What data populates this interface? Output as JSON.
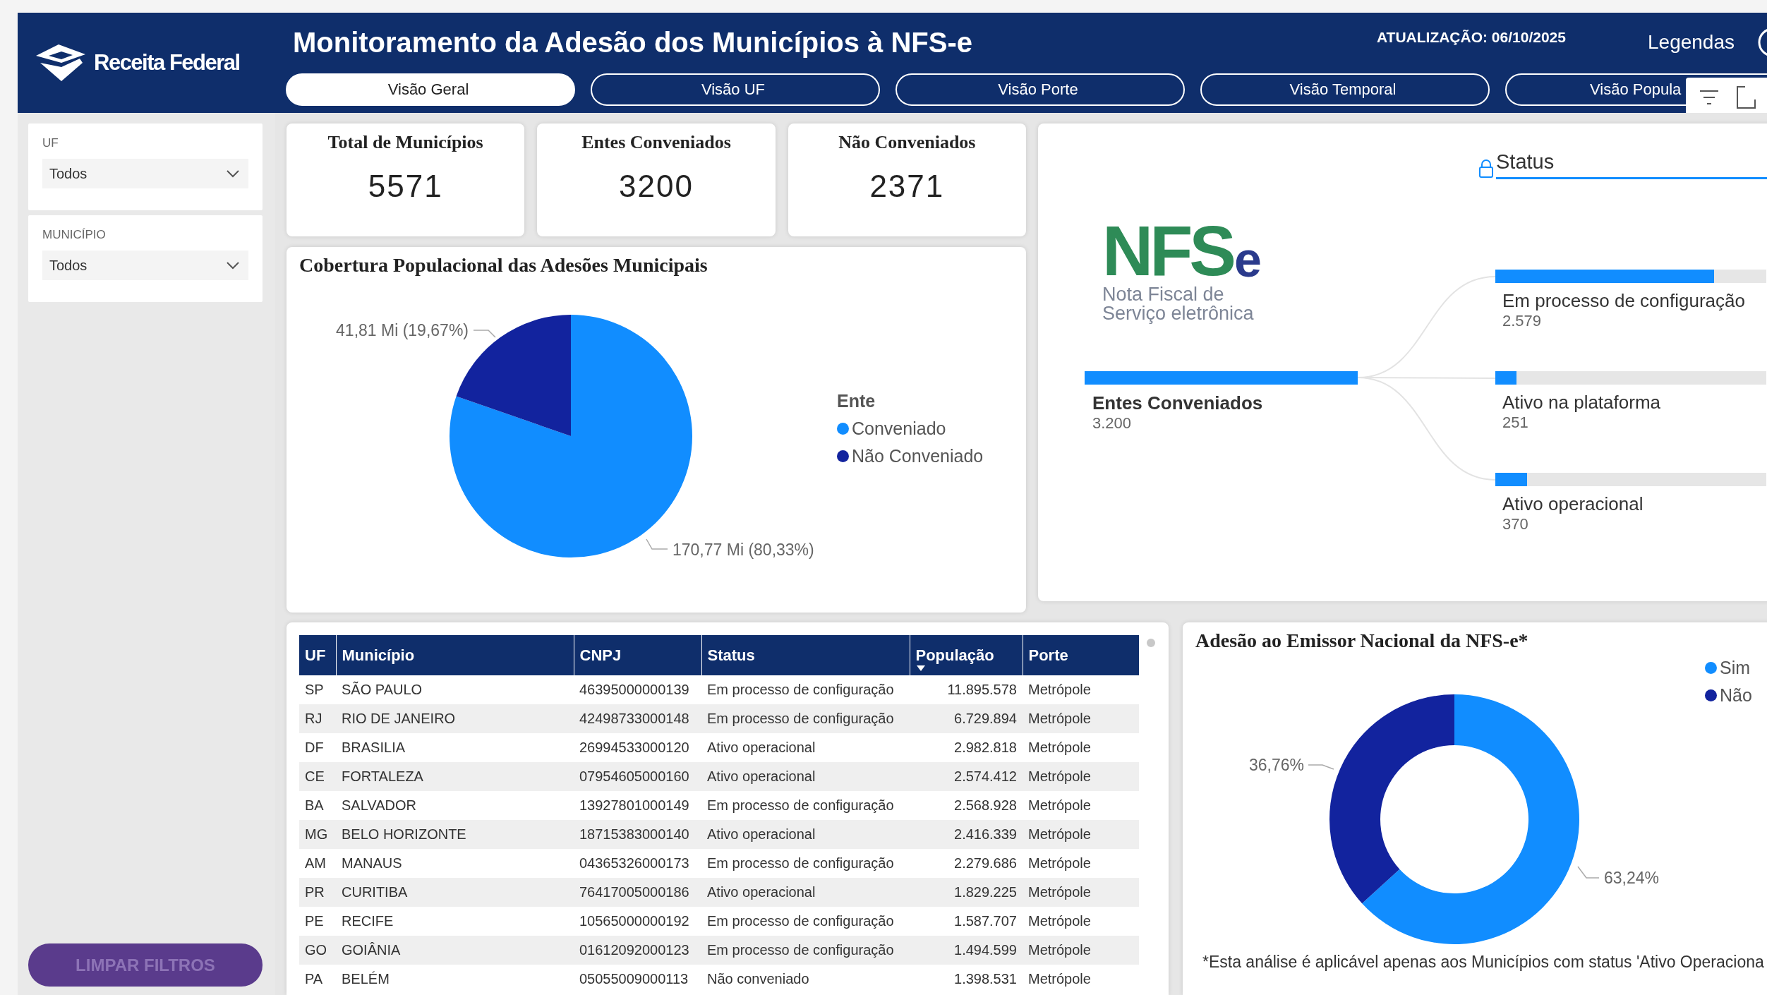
{
  "header": {
    "logo_text": "Receita Federal",
    "title": "Monitoramento da Adesão dos Municípios à NFS-e",
    "update": "ATUALIZAÇÃO: 06/10/2025",
    "legend_link": "Legendas",
    "tabs": [
      {
        "label": "Visão Geral",
        "selected": true
      },
      {
        "label": "Visão UF",
        "selected": false
      },
      {
        "label": "Visão Porte",
        "selected": false
      },
      {
        "label": "Visão Temporal",
        "selected": false
      },
      {
        "label": "Visão Popula",
        "selected": false
      }
    ]
  },
  "sidebar": {
    "slicers": [
      {
        "label": "UF",
        "value": "Todos"
      },
      {
        "label": "MUNICÍPIO",
        "value": "Todos"
      }
    ],
    "clear_button": "LIMPAR FILTROS"
  },
  "kpis": [
    {
      "label": "Total de Municípios",
      "value": "5571"
    },
    {
      "label": "Entes Conveniados",
      "value": "3200"
    },
    {
      "label": "Não Conveniados",
      "value": "2371"
    }
  ],
  "coverage": {
    "title": "Cobertura Populacional das Adesões Municipais",
    "legend_title": "Ente",
    "chart_data": {
      "type": "pie",
      "categories": [
        "Conveniado",
        "Não Conveniado"
      ],
      "values": [
        170.77,
        41.81
      ],
      "value_labels": [
        "170,77 Mi (80,33%)",
        "41,81 Mi (19,67%)"
      ]
    },
    "palette": [
      {
        "color": "#118dff"
      },
      {
        "color": "#12239e"
      }
    ]
  },
  "decomposition": {
    "logo_letters": "NFS",
    "logo_suffix": "e",
    "logo_caption": [
      "Nota Fiscal de",
      "Serviço eletrônica"
    ],
    "level_header": "Status",
    "root": {
      "label": "Entes Conveniados",
      "value": "3.200",
      "level": 1
    },
    "branches": [
      {
        "label": "Em processo de configuração",
        "value": "2.579",
        "level": 0.806
      },
      {
        "label": "Ativo na plataforma",
        "value": "251",
        "level": 0.078
      },
      {
        "label": "Ativo operacional",
        "value": "370",
        "level": 0.116
      }
    ]
  },
  "table": {
    "columns": [
      {
        "label": "UF",
        "sorted": false
      },
      {
        "label": "Município",
        "sorted": false
      },
      {
        "label": "CNPJ",
        "sorted": false
      },
      {
        "label": "Status",
        "sorted": false
      },
      {
        "label": "População",
        "sorted": true
      },
      {
        "label": "Porte",
        "sorted": false
      }
    ],
    "rows": [
      [
        "SP",
        "SÃO PAULO",
        "46395000000139",
        "Em processo de configuração",
        "11.895.578",
        "Metrópole"
      ],
      [
        "RJ",
        "RIO DE JANEIRO",
        "42498733000148",
        "Em processo de configuração",
        "6.729.894",
        "Metrópole"
      ],
      [
        "DF",
        "BRASILIA",
        "26994533000120",
        "Ativo operacional",
        "2.982.818",
        "Metrópole"
      ],
      [
        "CE",
        "FORTALEZA",
        "07954605000160",
        "Ativo operacional",
        "2.574.412",
        "Metrópole"
      ],
      [
        "BA",
        "SALVADOR",
        "13927801000149",
        "Em processo de configuração",
        "2.568.928",
        "Metrópole"
      ],
      [
        "MG",
        "BELO HORIZONTE",
        "18715383000140",
        "Ativo operacional",
        "2.416.339",
        "Metrópole"
      ],
      [
        "AM",
        "MANAUS",
        "04365326000173",
        "Em processo de configuração",
        "2.279.686",
        "Metrópole"
      ],
      [
        "PR",
        "CURITIBA",
        "76417005000186",
        "Ativo operacional",
        "1.829.225",
        "Metrópole"
      ],
      [
        "PE",
        "RECIFE",
        "10565000000192",
        "Em processo de configuração",
        "1.587.707",
        "Metrópole"
      ],
      [
        "GO",
        "GOIÂNIA",
        "01612092000123",
        "Em processo de configuração",
        "1.494.599",
        "Metrópole"
      ],
      [
        "PA",
        "BELÉM",
        "05055009000113",
        "Não conveniado",
        "1.398.531",
        "Metrópole"
      ]
    ]
  },
  "adhesion": {
    "title": "Adesão ao Emissor Nacional da NFS-e*",
    "chart_data": {
      "type": "donut",
      "categories": [
        "Sim",
        "Não"
      ],
      "values": [
        63.24,
        36.76
      ],
      "value_labels": [
        "63,24%",
        "36,76%"
      ]
    },
    "palette": [
      {
        "color": "#118dff"
      },
      {
        "color": "#12239e"
      }
    ],
    "footnote": "*Esta análise é aplicável apenas aos Municípios com status 'Ativo Operaciona"
  }
}
